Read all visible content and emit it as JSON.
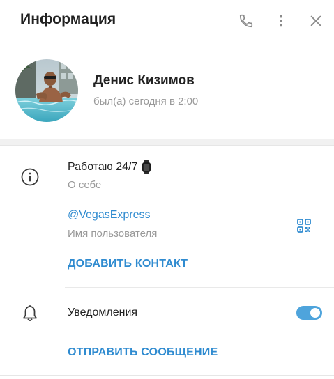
{
  "header": {
    "title": "Информация",
    "icons": [
      "phone-icon",
      "more-vertical-icon",
      "close-icon"
    ]
  },
  "profile": {
    "name": "Денис Кизимов",
    "status": "был(а) сегодня в 2:00"
  },
  "info": {
    "bio": "Работаю 24/7",
    "bio_emoji": "watch-icon",
    "bio_label": "О себе",
    "username": "@VegasExpress",
    "username_label": "Имя пользователя",
    "add_contact": "ДОБАВИТЬ КОНТАКТ"
  },
  "notifications": {
    "label": "Уведомления",
    "enabled": true
  },
  "actions": {
    "send_message": "ОТПРАВИТЬ СООБЩЕНИЕ"
  },
  "colors": {
    "accent": "#2f8bd0",
    "toggle": "#4ea4dc",
    "muted_text": "#999999",
    "icon_gray": "#8a8a8a"
  }
}
